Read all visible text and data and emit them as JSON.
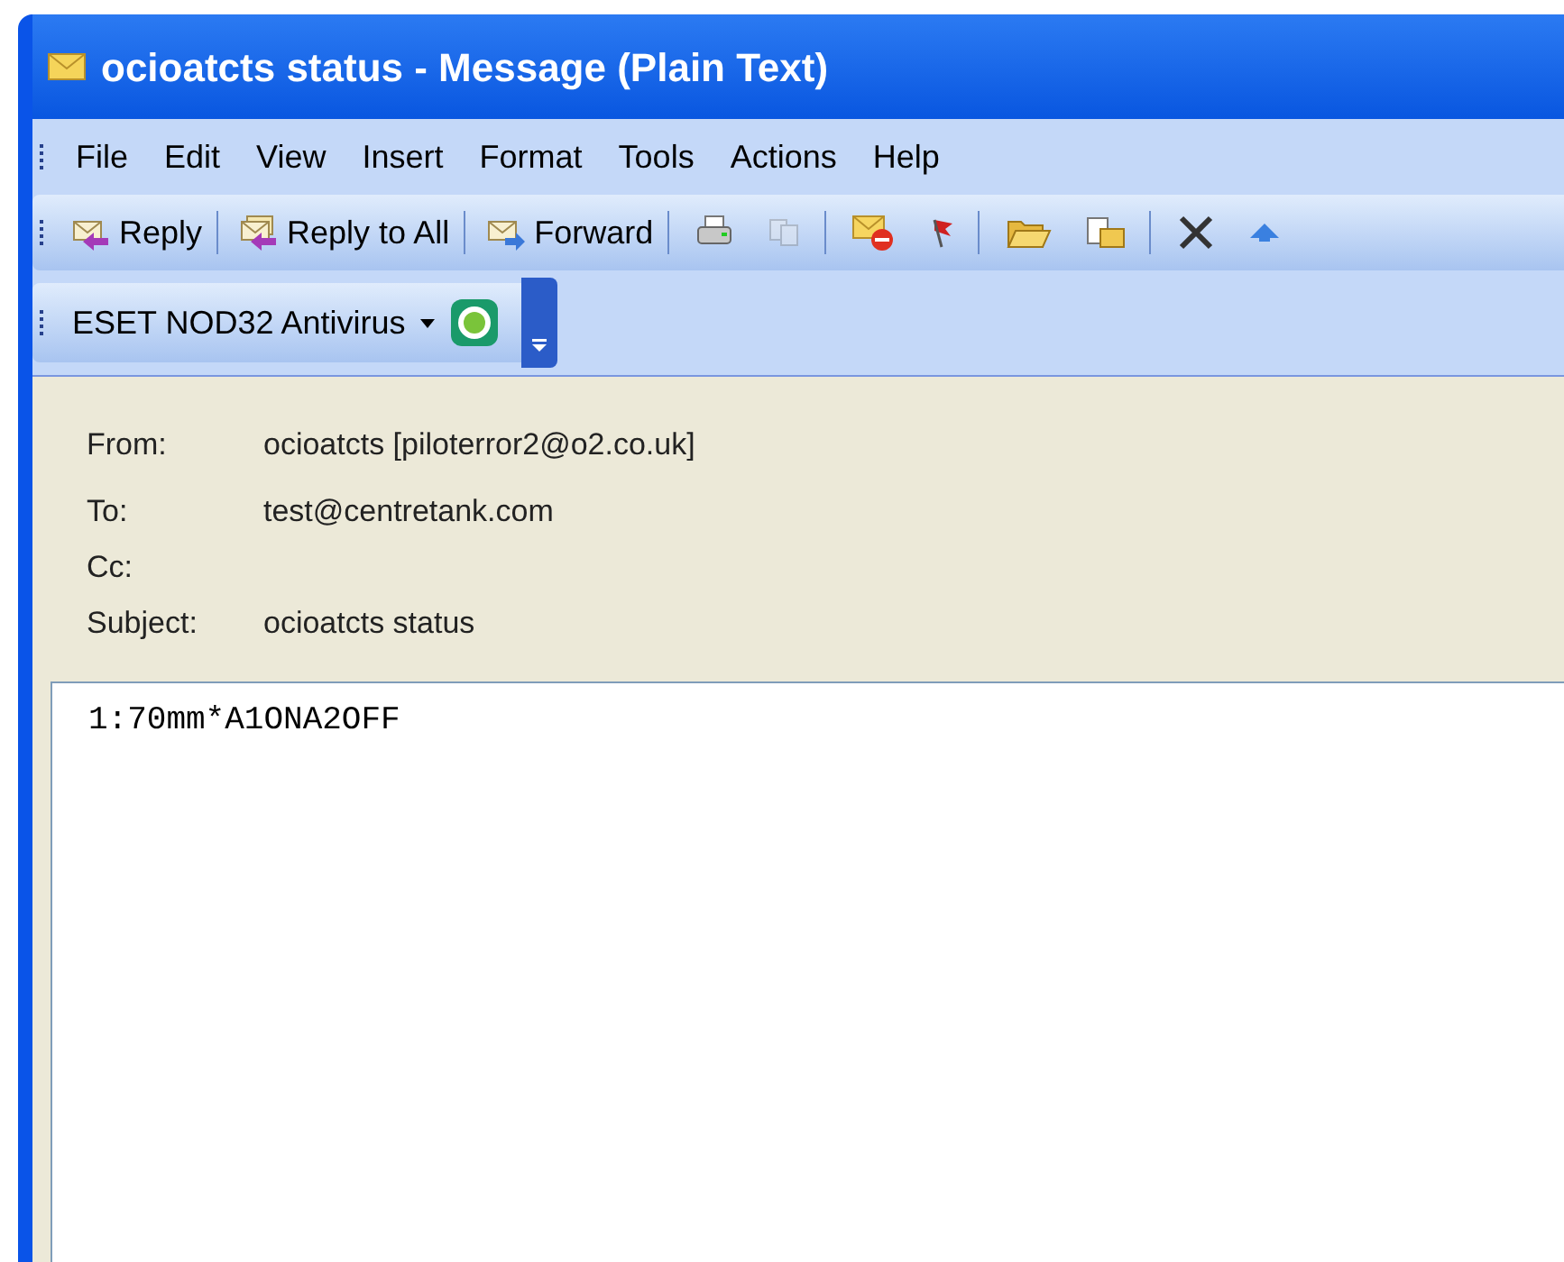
{
  "window": {
    "title": "ocioatcts status - Message (Plain Text)"
  },
  "menu": [
    "File",
    "Edit",
    "View",
    "Insert",
    "Format",
    "Tools",
    "Actions",
    "Help"
  ],
  "toolbar": [
    {
      "label": "Reply"
    },
    {
      "label": "Reply to All"
    },
    {
      "label": "Forward"
    }
  ],
  "toolbar_icons": [
    {
      "disabled": false
    },
    {
      "disabled": true
    },
    {
      "disabled": false
    },
    {
      "disabled": false
    },
    {
      "disabled": false
    },
    {
      "disabled": false
    },
    {
      "disabled": false
    },
    {
      "disabled": false
    }
  ],
  "antivirus_toolbar": {
    "label": "ESET NOD32 Antivirus"
  },
  "header": [
    {
      "label": "From:",
      "value": "ocioatcts [piloterror2@o2.co.uk]"
    },
    {
      "label": "To:",
      "value": "test@centretank.com"
    },
    {
      "label": "Cc:"
    },
    {
      "label": "Subject:",
      "value": "ocioatcts status"
    }
  ],
  "body": "1:70mm*A1ONA2OFF"
}
